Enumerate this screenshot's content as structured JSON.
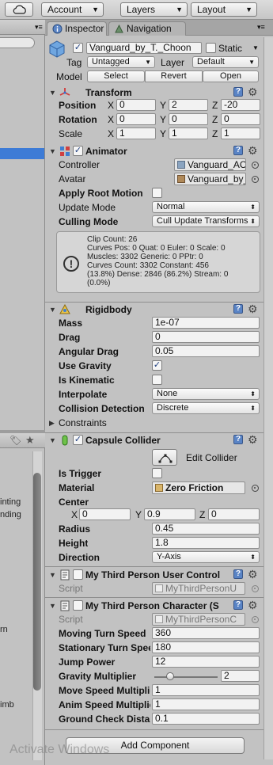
{
  "toolbar": {
    "account_label": "Account",
    "layers_label": "Layers",
    "layout_label": "Layout"
  },
  "left_panel": {
    "visible_snippets": [
      "inting",
      "nding",
      "rn",
      "imb"
    ]
  },
  "tabs": {
    "inspector": "Inspector",
    "navigation": "Navigation"
  },
  "object": {
    "name": "Vanguard_by_T._Choon",
    "active": true,
    "static_label": "Static",
    "static_checked": false,
    "tag_label": "Tag",
    "tag_value": "Untagged",
    "layer_label": "Layer",
    "layer_value": "Default",
    "model_label": "Model",
    "model_buttons": [
      "Select",
      "Revert",
      "Open"
    ]
  },
  "transform": {
    "title": "Transform",
    "rows": [
      {
        "label": "Position",
        "x": "0",
        "y": "2",
        "z": "-20"
      },
      {
        "label": "Rotation",
        "x": "0",
        "y": "0",
        "z": "0"
      },
      {
        "label": "Scale",
        "x": "1",
        "y": "1",
        "z": "1"
      }
    ],
    "axis_labels": [
      "X",
      "Y",
      "Z"
    ]
  },
  "animator": {
    "title": "Animator",
    "enabled": true,
    "controller_label": "Controller",
    "controller_value": "Vanguard_AC",
    "avatar_label": "Avatar",
    "avatar_value": "Vanguard_by_T._",
    "apply_root_motion_label": "Apply Root Motion",
    "apply_root_motion": false,
    "update_mode_label": "Update Mode",
    "update_mode_value": "Normal",
    "culling_mode_label": "Culling Mode",
    "culling_mode_value": "Cull Update Transforms",
    "info_lines": [
      "Clip Count: 26",
      "Curves Pos: 0 Quat: 0 Euler: 0 Scale: 0",
      "Muscles: 3302 Generic: 0 PPtr: 0",
      "Curves Count: 3302 Constant: 456",
      "(13.8%) Dense: 2846 (86.2%) Stream: 0",
      "(0.0%)"
    ]
  },
  "rigidbody": {
    "title": "Rigidbody",
    "mass_label": "Mass",
    "mass": "1e-07",
    "drag_label": "Drag",
    "drag": "0",
    "angular_drag_label": "Angular Drag",
    "angular_drag": "0.05",
    "use_gravity_label": "Use Gravity",
    "use_gravity": true,
    "is_kinematic_label": "Is Kinematic",
    "is_kinematic": false,
    "interpolate_label": "Interpolate",
    "interpolate_value": "None",
    "collision_label": "Collision Detection",
    "collision_value": "Discrete",
    "constraints_label": "Constraints"
  },
  "capsule": {
    "title": "Capsule Collider",
    "enabled": true,
    "edit_collider_label": "Edit Collider",
    "is_trigger_label": "Is Trigger",
    "is_trigger": false,
    "material_label": "Material",
    "material_value": "Zero Friction",
    "center_label": "Center",
    "center": {
      "x": "0",
      "y": "0.9",
      "z": "0"
    },
    "radius_label": "Radius",
    "radius": "0.45",
    "height_label": "Height",
    "height": "1.8",
    "direction_label": "Direction",
    "direction_value": "Y-Axis"
  },
  "user_control": {
    "title": "My Third Person User Control",
    "enabled": false,
    "script_label": "Script",
    "script_value": "MyThirdPersonU"
  },
  "character": {
    "title": "My Third Person Character (S",
    "enabled": false,
    "script_label": "Script",
    "script_value": "MyThirdPersonC",
    "fields": [
      {
        "label": "Moving Turn Speed",
        "value": "360"
      },
      {
        "label": "Stationary Turn Speed",
        "value": "180"
      },
      {
        "label": "Jump Power",
        "value": "12"
      }
    ],
    "gravity_label": "Gravity Multiplier",
    "gravity_value": "2",
    "gravity_slider_fraction": 0.25,
    "fields2": [
      {
        "label": "Move Speed Multiplier",
        "value": "1"
      },
      {
        "label": "Anim Speed Multiplier",
        "value": "1"
      },
      {
        "label": "Ground Check Distance",
        "value": "0.1"
      }
    ]
  },
  "add_component_label": "Add Component",
  "watermark": "Activate Windows"
}
